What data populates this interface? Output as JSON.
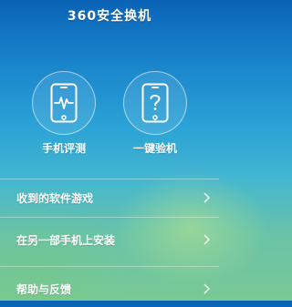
{
  "header": {
    "title": "360安全换机"
  },
  "features": [
    {
      "label": "手机评测",
      "icon": "phone-pulse-icon"
    },
    {
      "label": "一键验机",
      "icon": "phone-question-icon"
    }
  ],
  "menu": [
    {
      "label": "收到的软件游戏"
    },
    {
      "label": "在另一部手机上安装"
    },
    {
      "label": "帮助与反馈"
    }
  ],
  "colors": {
    "text": "#ffffff",
    "background_top": "#0a63b6",
    "background_bottom": "#79c995"
  }
}
